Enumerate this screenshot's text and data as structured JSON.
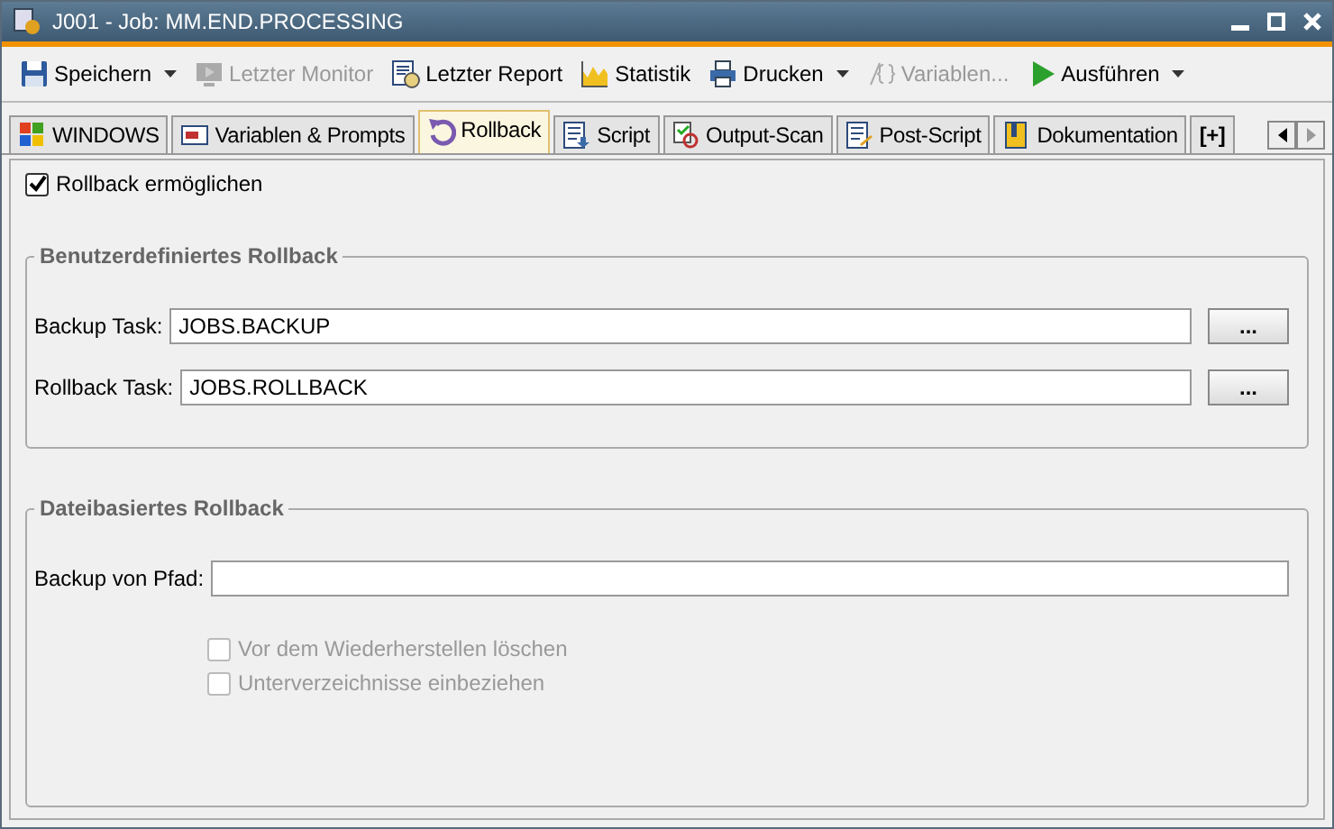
{
  "window": {
    "title": "J001 - Job: MM.END.PROCESSING"
  },
  "toolbar": [
    {
      "label": "Speichern",
      "kind": "split",
      "disabled": false
    },
    {
      "label": "Letzter Monitor",
      "kind": "button",
      "disabled": true
    },
    {
      "label": "Letzter Report",
      "kind": "button",
      "disabled": false
    },
    {
      "label": "Statistik",
      "kind": "button",
      "disabled": false
    },
    {
      "label": "Drucken",
      "kind": "split",
      "disabled": false
    },
    {
      "label": "Variablen...",
      "kind": "button",
      "disabled": true
    },
    {
      "label": "Ausführen",
      "kind": "split",
      "disabled": false
    }
  ],
  "tabs": [
    {
      "label": "WINDOWS",
      "selected": false
    },
    {
      "label": "Variablen & Prompts",
      "selected": false
    },
    {
      "label": "Rollback",
      "selected": true
    },
    {
      "label": "Script",
      "selected": false
    },
    {
      "label": "Output-Scan",
      "selected": false
    },
    {
      "label": "Post-Script",
      "selected": false
    },
    {
      "label": "Dokumentation",
      "selected": false
    },
    {
      "label": "[+]",
      "selected": false
    }
  ],
  "enable_rollback": {
    "label": "Rollback ermöglichen",
    "checked": true
  },
  "custom_rollback": {
    "title": "Benutzerdefiniertes Rollback",
    "fields": [
      {
        "label": "Backup Task:",
        "value": "JOBS.BACKUP",
        "button": "..."
      },
      {
        "label": "Rollback Task:",
        "value": "JOBS.ROLLBACK",
        "button": "..."
      }
    ]
  },
  "file_rollback": {
    "title": "Dateibasiertes Rollback",
    "path_label": "Backup von Pfad:",
    "options": [
      {
        "label": "Vor dem Wiederherstellen löschen",
        "checked": false,
        "disabled": true
      },
      {
        "label": "Unterverzeichnisse einbeziehen",
        "checked": false,
        "disabled": true
      }
    ]
  }
}
